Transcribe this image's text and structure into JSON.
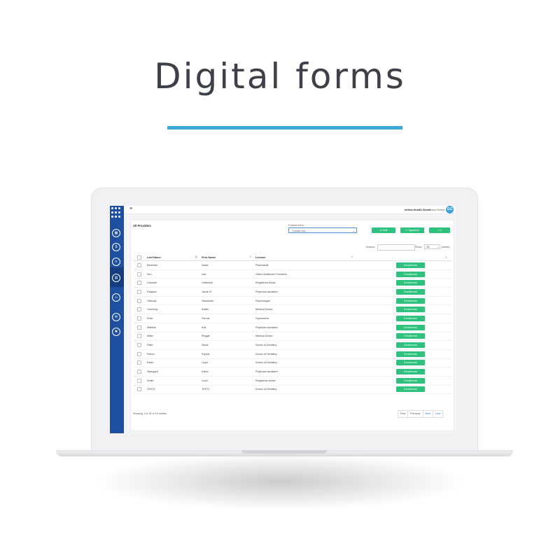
{
  "hero": {
    "title": "Digital forms"
  },
  "colors": {
    "accent": "#3aa8d8",
    "sidebar": "#1f4fa0",
    "green_button": "#2ec27e"
  },
  "app": {
    "menu_icon": "≡",
    "org_name": "Initiva Health Demo",
    "user_name": "- Gloria Green",
    "avatar_initials": "GG",
    "sidebar_icons": [
      "grid-icon",
      "dollar-icon",
      "list-icon",
      "id-card-icon",
      "users-icon",
      "chat-icon",
      "settings-icon"
    ]
  },
  "panel": {
    "title": "All Providers",
    "custom_form_label": "Custom form",
    "custom_form_value": "Choose one...",
    "buttons": {
      "mail": "✉ Mail",
      "signature": "✎ Signature",
      "add": "+ ⚲"
    },
    "search_label": "Search:",
    "show_label": "Show",
    "show_value": "15",
    "entries_label": "entries"
  },
  "table": {
    "columns": [
      "Last Name",
      "First Name",
      "License"
    ],
    "action_label": "Enrollments",
    "rows": [
      {
        "last": "Beckham",
        "first": "David",
        "license": "Pharmacist"
      },
      {
        "last": "Sen",
        "first": "sha",
        "license": "Other Healthcare Providers"
      },
      {
        "last": "Crandall",
        "first": "Catherine",
        "license": "Registered Nurse"
      },
      {
        "last": "Delgado",
        "first": "Jacob III",
        "license": "Physician Assistant"
      },
      {
        "last": "Gilhooly",
        "first": "Samantha",
        "license": "Psychologist"
      },
      {
        "last": "Goehring",
        "first": "Adelle",
        "license": "Medical Doctor"
      },
      {
        "last": "Khan",
        "first": "Farouk",
        "license": "Optometrist"
      },
      {
        "last": "Mathew",
        "first": "Erik",
        "license": "Physician Assistant"
      },
      {
        "last": "Miller",
        "first": "Reggie",
        "license": "Medical Doctor"
      },
      {
        "last": "Patel",
        "first": "Samir",
        "license": "Doctor of Dentistry"
      },
      {
        "last": "Petros",
        "first": "Sophia",
        "license": "Doctor of Dentistry"
      },
      {
        "last": "Reich",
        "first": "Lloyd",
        "license": "Doctor of Dentistry"
      },
      {
        "last": "Skangard",
        "first": "Katrin",
        "license": "Physician Assistant"
      },
      {
        "last": "Smith",
        "first": "Carol",
        "license": "Registered Nurse"
      },
      {
        "last": "TEST2",
        "first": "TEST1",
        "license": "Doctor of Dentistry"
      }
    ],
    "footer_info": "Showing 1 to 15 of 19 entries",
    "pagination": [
      "First",
      "Previous",
      "Next",
      "Last"
    ]
  }
}
